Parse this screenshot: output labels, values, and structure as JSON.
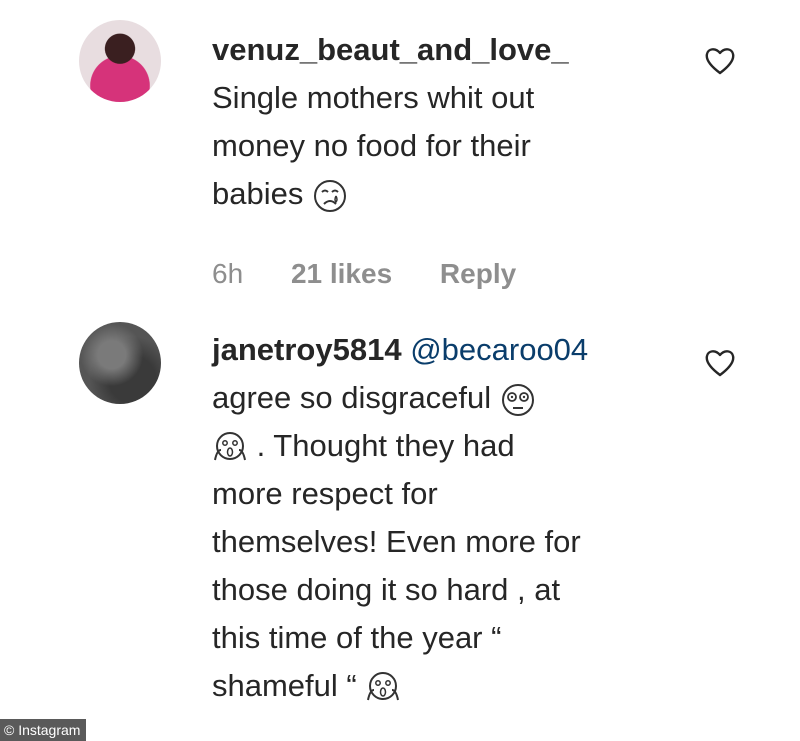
{
  "comments": [
    {
      "username": "venuz_beaut_and_love_",
      "lines": [
        "Single mothers whit out",
        "money no food for their",
        "babies"
      ],
      "emoji": "crying-face-icon",
      "time": "6h",
      "likes": "21 likes",
      "reply": "Reply"
    },
    {
      "username": "janetroy5814",
      "mention": "@becaroo04",
      "line1": "agree so disgraceful",
      "line2": ". Thought they had",
      "lines": [
        "more respect for",
        "themselves! Even more for",
        "those doing it so hard , at",
        "this time of the year “"
      ],
      "last_line": "shameful “"
    }
  ],
  "watermark": "© Instagram"
}
